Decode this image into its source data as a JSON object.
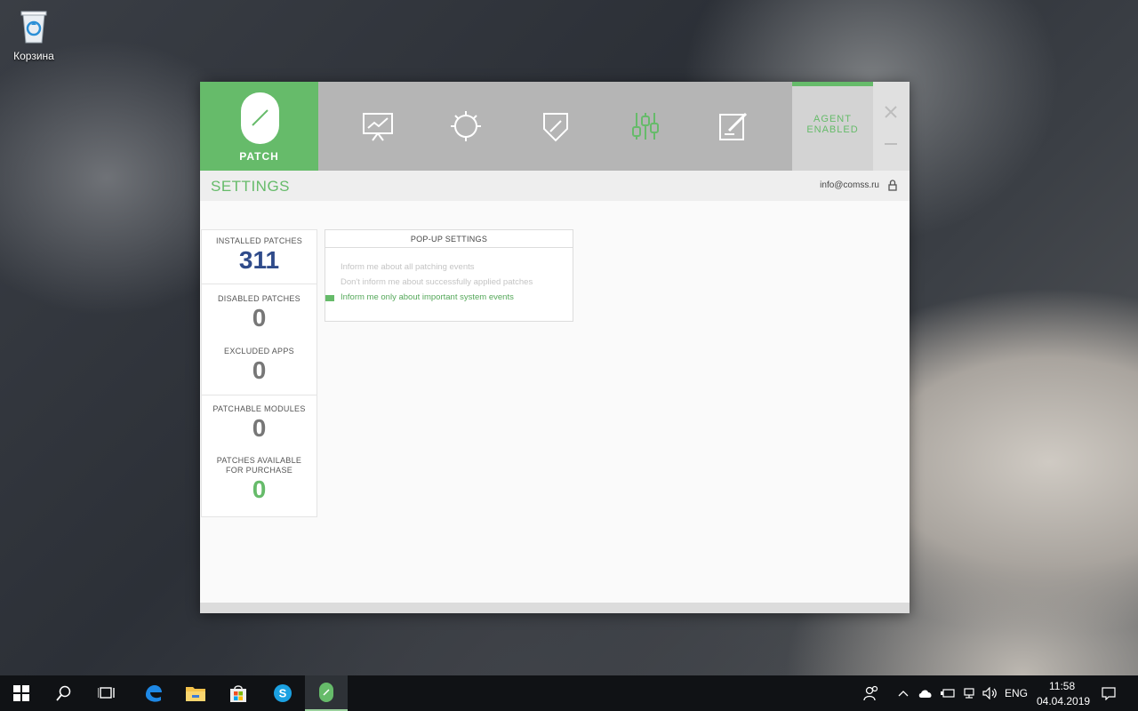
{
  "desktop": {
    "recycle_bin_label": "Корзина"
  },
  "app": {
    "brand_label": "PATCH",
    "agent_status": [
      "AGENT",
      "ENABLED"
    ],
    "nav": [
      "reports-icon",
      "scan-icon",
      "shield-icon",
      "settings-icon",
      "edit-icon"
    ],
    "active_nav": "settings-icon",
    "accent_color": "#66bb6a",
    "section_title": "SETTINGS",
    "account_email": "info@comss.ru",
    "stats": [
      {
        "label": "INSTALLED PATCHES",
        "value": "311",
        "color": "#2f4b8a"
      },
      {
        "label": "DISABLED PATCHES",
        "value": "0",
        "color": "#777777"
      },
      {
        "label": "EXCLUDED APPS",
        "value": "0",
        "color": "#777777"
      },
      {
        "label": "PATCHABLE MODULES",
        "value": "0",
        "color": "#777777"
      },
      {
        "label": "PATCHES AVAILABLE FOR PURCHASE",
        "value": "0",
        "color": "#66bb6a"
      }
    ],
    "popup_settings": {
      "title": "POP-UP SETTINGS",
      "options": [
        "Inform me about all patching events",
        "Don't inform me about successfully applied patches",
        "Inform me only about important system events"
      ],
      "selected_index": 2
    }
  },
  "taskbar": {
    "language": "ENG",
    "time": "11:58",
    "date": "04.04.2019",
    "pinned": [
      "start-icon",
      "search-icon",
      "task-view-icon",
      "edge-icon",
      "explorer-icon",
      "store-icon",
      "skype-icon",
      "patch-app-icon"
    ]
  }
}
